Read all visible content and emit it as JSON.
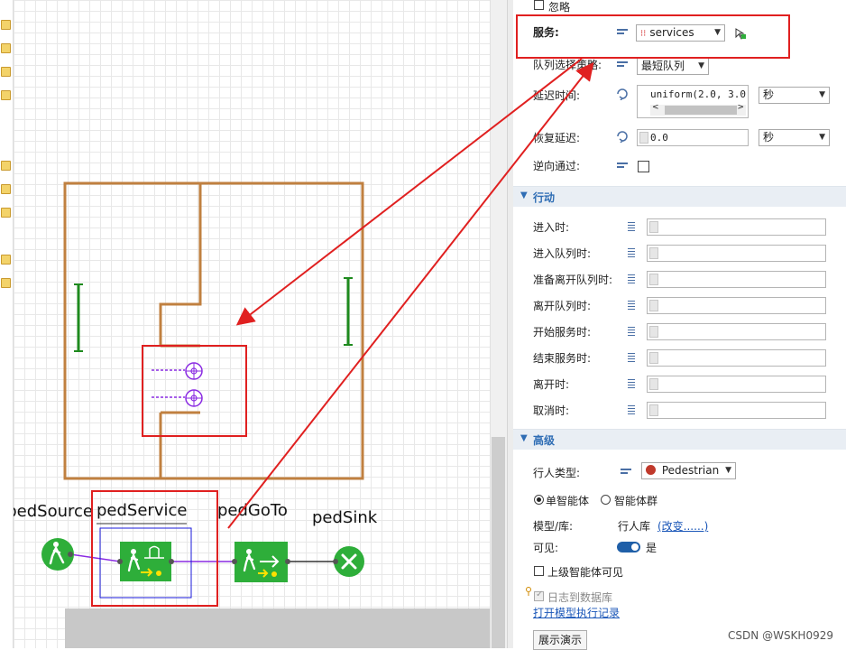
{
  "diagram": {
    "nodes": {
      "source": "pedSource",
      "service": "pedService",
      "goto": "pedGoTo",
      "sink": "pedSink"
    }
  },
  "props": {
    "ignore_label": "忽略",
    "services_label": "服务:",
    "services_value": "services",
    "queue_policy_label": "队列选择策略:",
    "queue_policy_value": "最短队列",
    "delay_label": "延迟时间:",
    "delay_value": "uniform(2.0, 3.0",
    "delay_unit": "秒",
    "recovery_label": "恢复延迟:",
    "recovery_value": "0.0",
    "recovery_unit": "秒",
    "reverse_label": "逆向通过:",
    "actions_header": "行动",
    "actions": [
      "进入时:",
      "进入队列时:",
      "准备离开队列时:",
      "离开队列时:",
      "开始服务时:",
      "结束服务时:",
      "离开时:",
      "取消时:"
    ],
    "advanced_header": "高级",
    "ped_type_label": "行人类型:",
    "ped_type_value": "Pedestrian",
    "single_agent": "单智能体",
    "agent_group": "智能体群",
    "model_lib_label": "模型/库:",
    "model_lib_value": "行人库",
    "change_link": "(改变......)",
    "visible_label": "可见:",
    "visible_value": "是",
    "parent_visible": "上级智能体可见",
    "log_to_db": "日志到数据库",
    "open_log_link": "打开模型执行记录",
    "demo_button": "展示演示"
  },
  "watermark": "CSDN @WSKH0929",
  "colors": {
    "accent_blue": "#2f6db4",
    "annotation_red": "#e02020",
    "wall_brown": "#c08040",
    "node_green": "#2eae3a",
    "connector_purple": "#8a2be2"
  }
}
